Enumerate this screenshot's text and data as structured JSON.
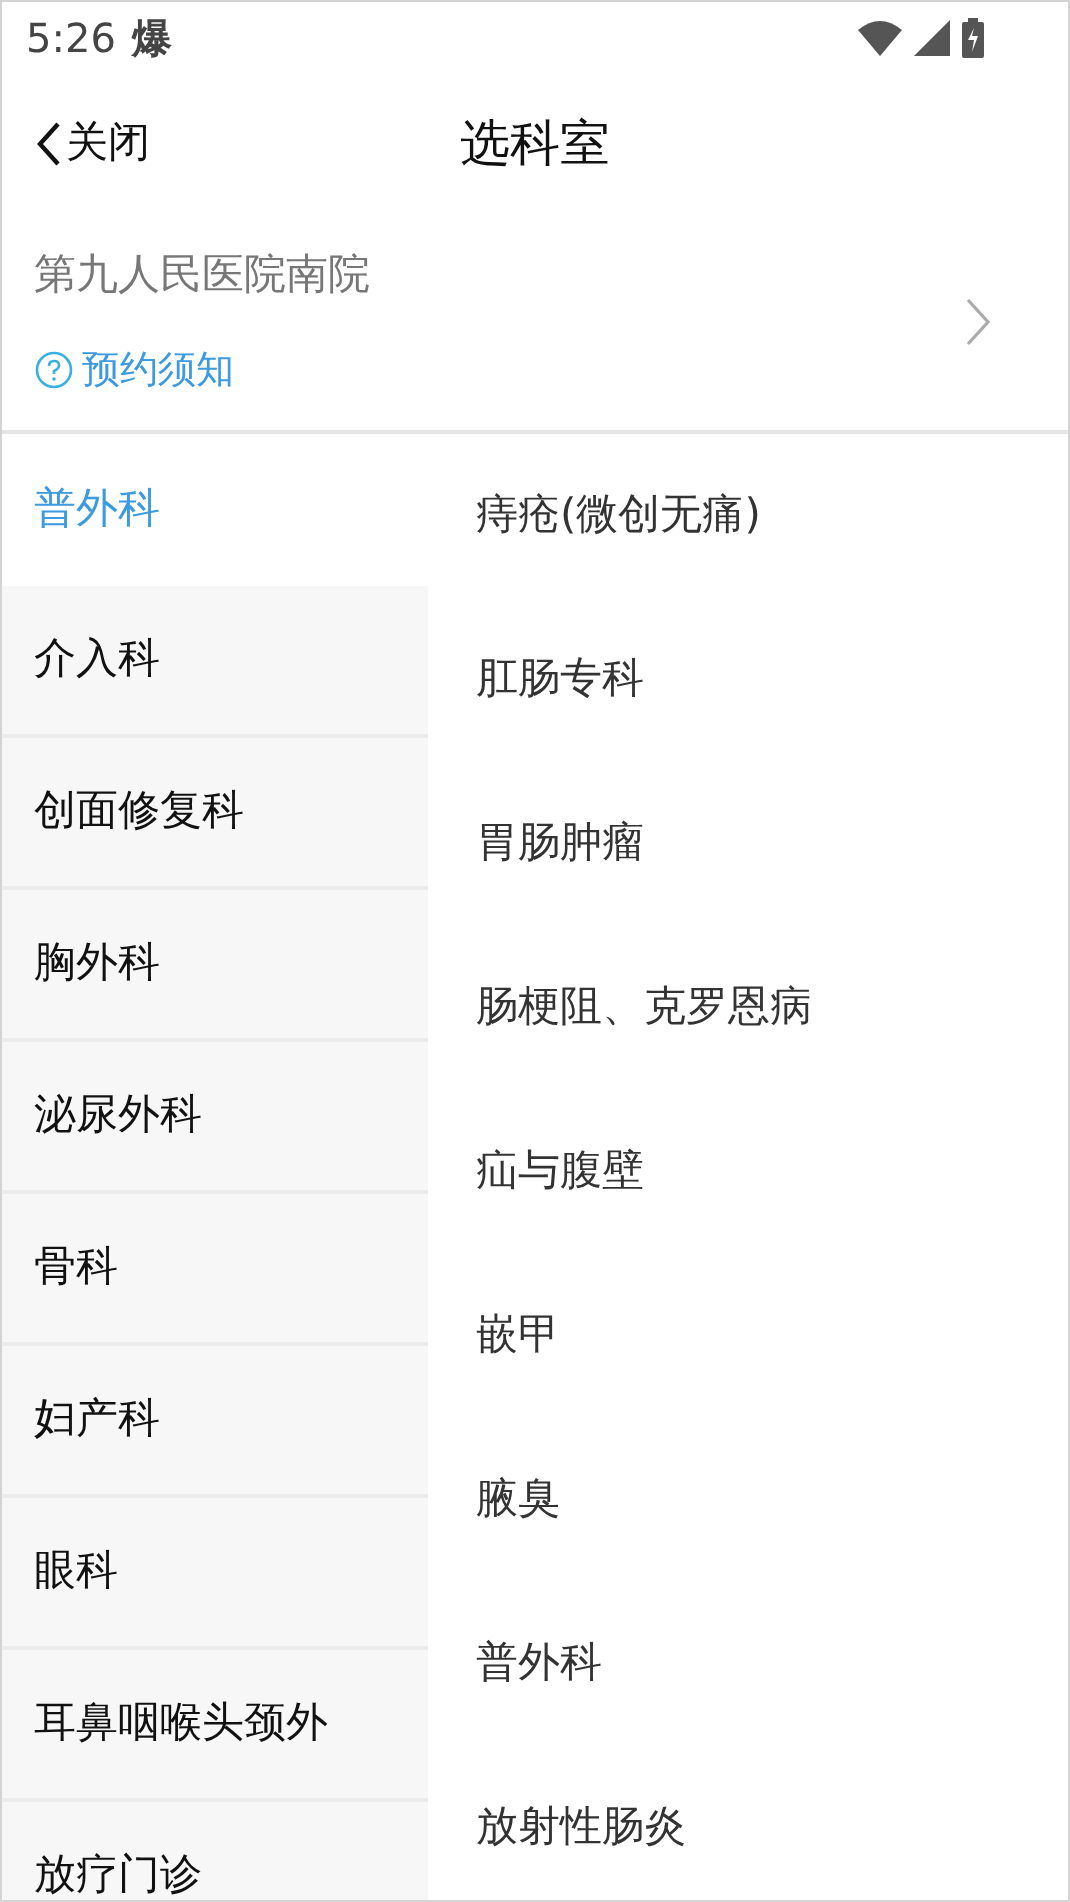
{
  "status_bar": {
    "time": "5:26",
    "notification": "爆"
  },
  "nav": {
    "back": "关闭",
    "title": "选科室"
  },
  "hospital": {
    "name": "第九人民医院南院",
    "notice_link": "预约须知"
  },
  "departments": [
    {
      "label": "普外科",
      "selected": true
    },
    {
      "label": "介入科",
      "selected": false
    },
    {
      "label": "创面修复科",
      "selected": false
    },
    {
      "label": "胸外科",
      "selected": false
    },
    {
      "label": "泌尿外科",
      "selected": false
    },
    {
      "label": "骨科",
      "selected": false
    },
    {
      "label": "妇产科",
      "selected": false
    },
    {
      "label": "眼科",
      "selected": false
    },
    {
      "label": "耳鼻咽喉头颈外",
      "selected": false
    },
    {
      "label": "放疗门诊",
      "selected": false
    }
  ],
  "clinics": [
    "痔疮(微创无痛)",
    "肛肠专科",
    "胃肠肿瘤",
    "肠梗阻、克罗恩病",
    "疝与腹壁",
    "嵌甲",
    "腋臭",
    "普外科",
    "放射性肠炎"
  ]
}
